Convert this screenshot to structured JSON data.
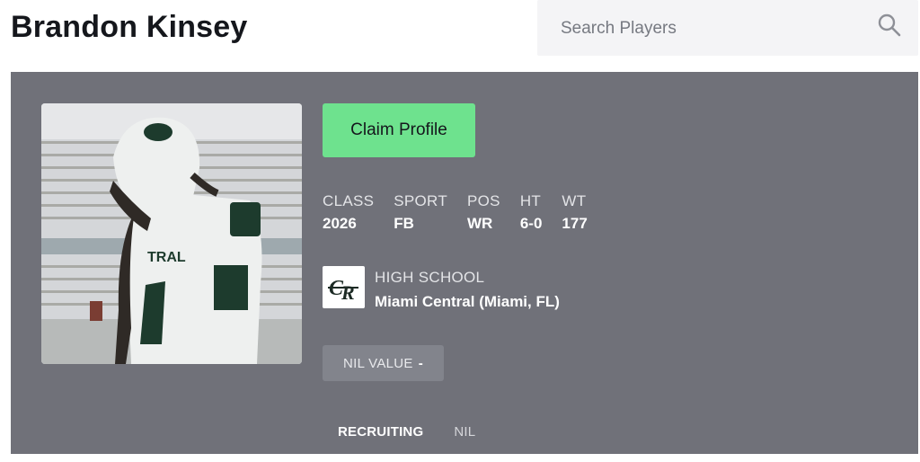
{
  "header": {
    "player_name": "Brandon Kinsey",
    "search": {
      "placeholder": "Search Players",
      "value": ""
    }
  },
  "profile": {
    "claim_label": "Claim Profile",
    "stats": [
      {
        "label": "CLASS",
        "value": "2026"
      },
      {
        "label": "SPORT",
        "value": "FB"
      },
      {
        "label": "POS",
        "value": "WR"
      },
      {
        "label": "HT",
        "value": "6-0"
      },
      {
        "label": "WT",
        "value": "177"
      }
    ],
    "school": {
      "label": "HIGH SCHOOL",
      "name": "Miami Central (Miami, FL)",
      "logo_icon": "school-logo-cr"
    },
    "nil": {
      "label": "NIL VALUE",
      "value": "-"
    }
  },
  "tabs": [
    {
      "label": "RECRUITING",
      "active": true
    },
    {
      "label": "NIL",
      "active": false
    }
  ],
  "colors": {
    "panel": "#707179",
    "accent": "#6ee28e",
    "search_bg": "#f4f4f6"
  }
}
